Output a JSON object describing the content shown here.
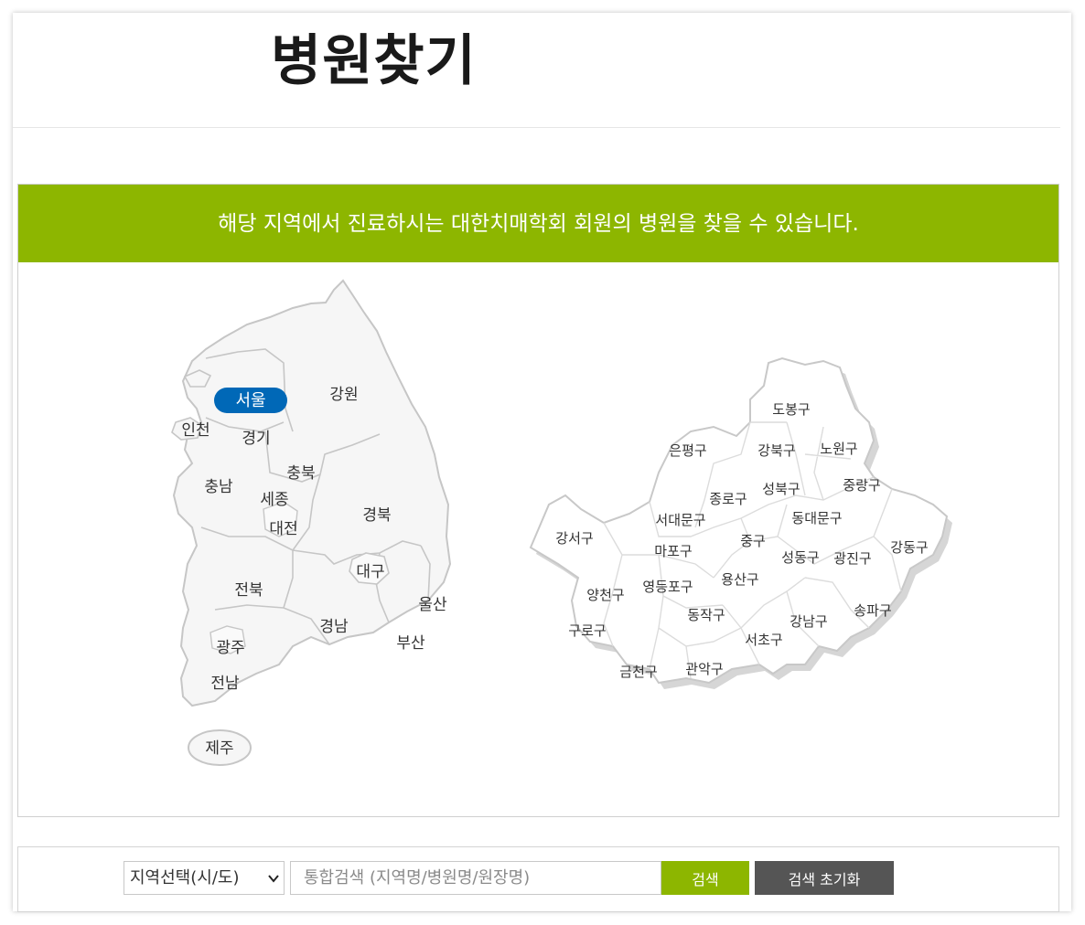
{
  "page": {
    "title": "병원찾기"
  },
  "banner": {
    "text": "해당 지역에서 진료하시는 대한치매학회 회원의 병원을 찾을 수 있습니다."
  },
  "korea_map": {
    "selected": "서울",
    "regions": [
      "서울",
      "강원",
      "인천",
      "경기",
      "충북",
      "충남",
      "세종",
      "경북",
      "대전",
      "대구",
      "전북",
      "울산",
      "경남",
      "부산",
      "광주",
      "전남",
      "제주"
    ]
  },
  "seoul_map": {
    "districts": [
      "도봉구",
      "은평구",
      "강북구",
      "노원구",
      "성북구",
      "종로구",
      "중랑구",
      "서대문구",
      "동대문구",
      "강서구",
      "중구",
      "강동구",
      "마포구",
      "성동구",
      "광진구",
      "용산구",
      "양천구",
      "영등포구",
      "송파구",
      "동작구",
      "강남구",
      "구로구",
      "서초구",
      "금천구",
      "관악구"
    ]
  },
  "search": {
    "region_select": "지역선택(시/도)",
    "placeholder": "통합검색 (지역명/병원명/원장명)",
    "search_label": "검색",
    "reset_label": "검색 초기화"
  },
  "colors": {
    "accent": "#8db600",
    "selected": "#0068b7",
    "reset": "#555555"
  }
}
